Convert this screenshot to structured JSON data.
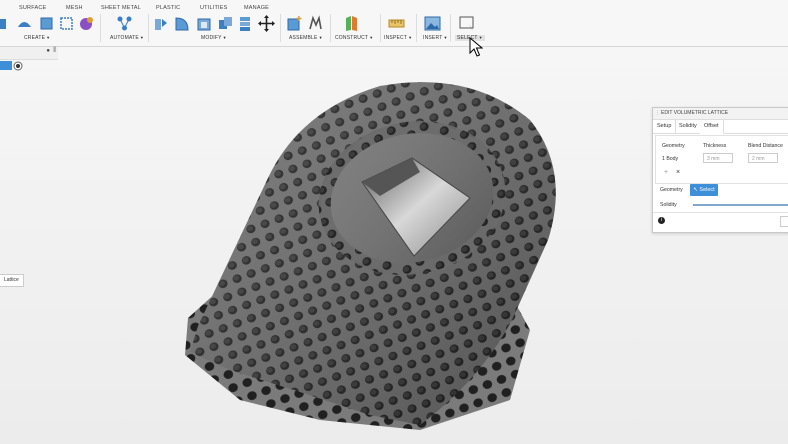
{
  "toolbar": {
    "tabs": [
      "SURFACE",
      "MESH",
      "SHEET METAL",
      "PLASTIC",
      "UTILITIES",
      "MANAGE"
    ],
    "groups": {
      "create": "CREATE",
      "automate": "AUTOMATE",
      "modify": "MODIFY",
      "assemble": "ASSEMBLE",
      "construct": "CONSTRUCT",
      "inspect": "INSPECT",
      "insert": "INSERT",
      "select": "SELECT"
    }
  },
  "browser": {
    "side_label": "Lattice"
  },
  "dialog": {
    "title": "EDIT VOLUMETRIC LATTICE",
    "tabs": [
      "Setup",
      "Solidity",
      "Offset"
    ],
    "active_tab": "Offset",
    "columns": [
      "Geometry",
      "Thickness",
      "Blend Distance"
    ],
    "row": {
      "geometry": "1 Body",
      "thickness": "3 mm",
      "blend": "2 mm"
    },
    "geometry_label": "Geometry",
    "select_label": "Select",
    "solidity_label": "Solidity"
  },
  "colors": {
    "accent": "#3d8fd8",
    "lattice": "#6e6e6e"
  }
}
